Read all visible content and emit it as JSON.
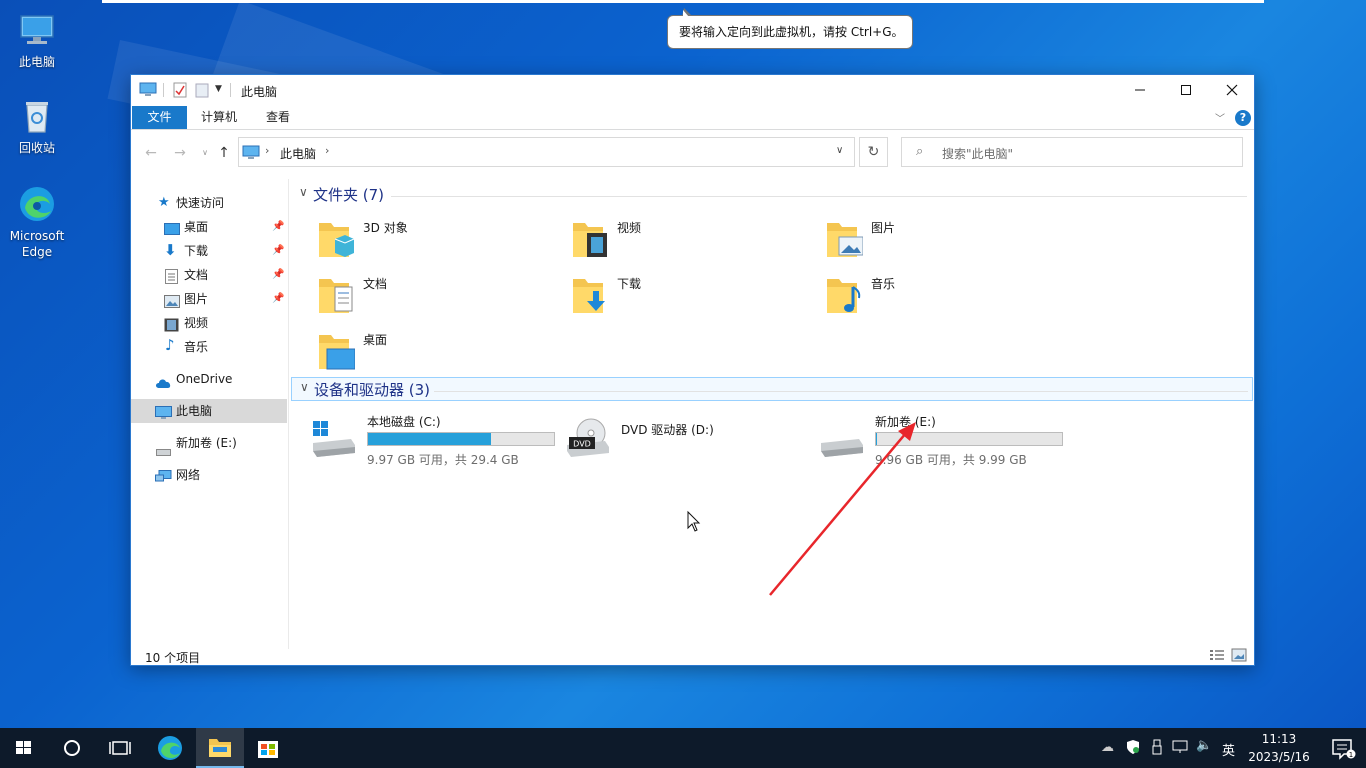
{
  "desktop": {
    "icons": [
      {
        "label": "此电脑"
      },
      {
        "label": "回收站"
      },
      {
        "label": "Microsoft Edge"
      }
    ]
  },
  "tooltip": {
    "text": "要将输入定向到此虚拟机，请按 Ctrl+G。"
  },
  "window": {
    "title": "此电脑",
    "ribbon_tabs": [
      {
        "label": "文件",
        "active": true
      },
      {
        "label": "计算机",
        "active": false
      },
      {
        "label": "查看",
        "active": false
      }
    ],
    "address": {
      "crumb": "此电脑"
    },
    "search": {
      "placeholder": "搜索\"此电脑\""
    },
    "sidebar": {
      "quick_access": "快速访问",
      "pinned": [
        {
          "label": "桌面"
        },
        {
          "label": "下载"
        },
        {
          "label": "文档"
        },
        {
          "label": "图片"
        }
      ],
      "unpinned": [
        {
          "label": "视频"
        },
        {
          "label": "音乐"
        }
      ],
      "onedrive": "OneDrive",
      "this_pc": "此电脑",
      "new_volume": "新加卷 (E:)",
      "network": "网络"
    },
    "groups": {
      "folders_title": "文件夹 (7)",
      "devices_title": "设备和驱动器 (3)"
    },
    "folders": [
      {
        "name": "3D 对象",
        "icon": "3d-objects-icon"
      },
      {
        "name": "视频",
        "icon": "videos-icon"
      },
      {
        "name": "图片",
        "icon": "pictures-icon"
      },
      {
        "name": "文档",
        "icon": "documents-icon"
      },
      {
        "name": "下载",
        "icon": "downloads-icon"
      },
      {
        "name": "音乐",
        "icon": "music-icon"
      },
      {
        "name": "桌面",
        "icon": "desktop-icon"
      }
    ],
    "drives": [
      {
        "name": "本地磁盘 (C:)",
        "info": "9.97 GB 可用，共 29.4 GB",
        "used_fraction": 0.66,
        "has_bar": true
      },
      {
        "name": "DVD 驱动器 (D:)",
        "info": "",
        "has_bar": false
      },
      {
        "name": "新加卷 (E:)",
        "info": "9.96 GB 可用，共 9.99 GB",
        "used_fraction": 0.003,
        "has_bar": true
      }
    ],
    "status": "10 个项目"
  },
  "taskbar": {
    "ime": "英",
    "time": "11:13",
    "date": "2023/5/16"
  },
  "colors": {
    "accent": "#1979ca",
    "bar_fill": "#26a0da",
    "annotation_arrow": "#e8262b"
  }
}
